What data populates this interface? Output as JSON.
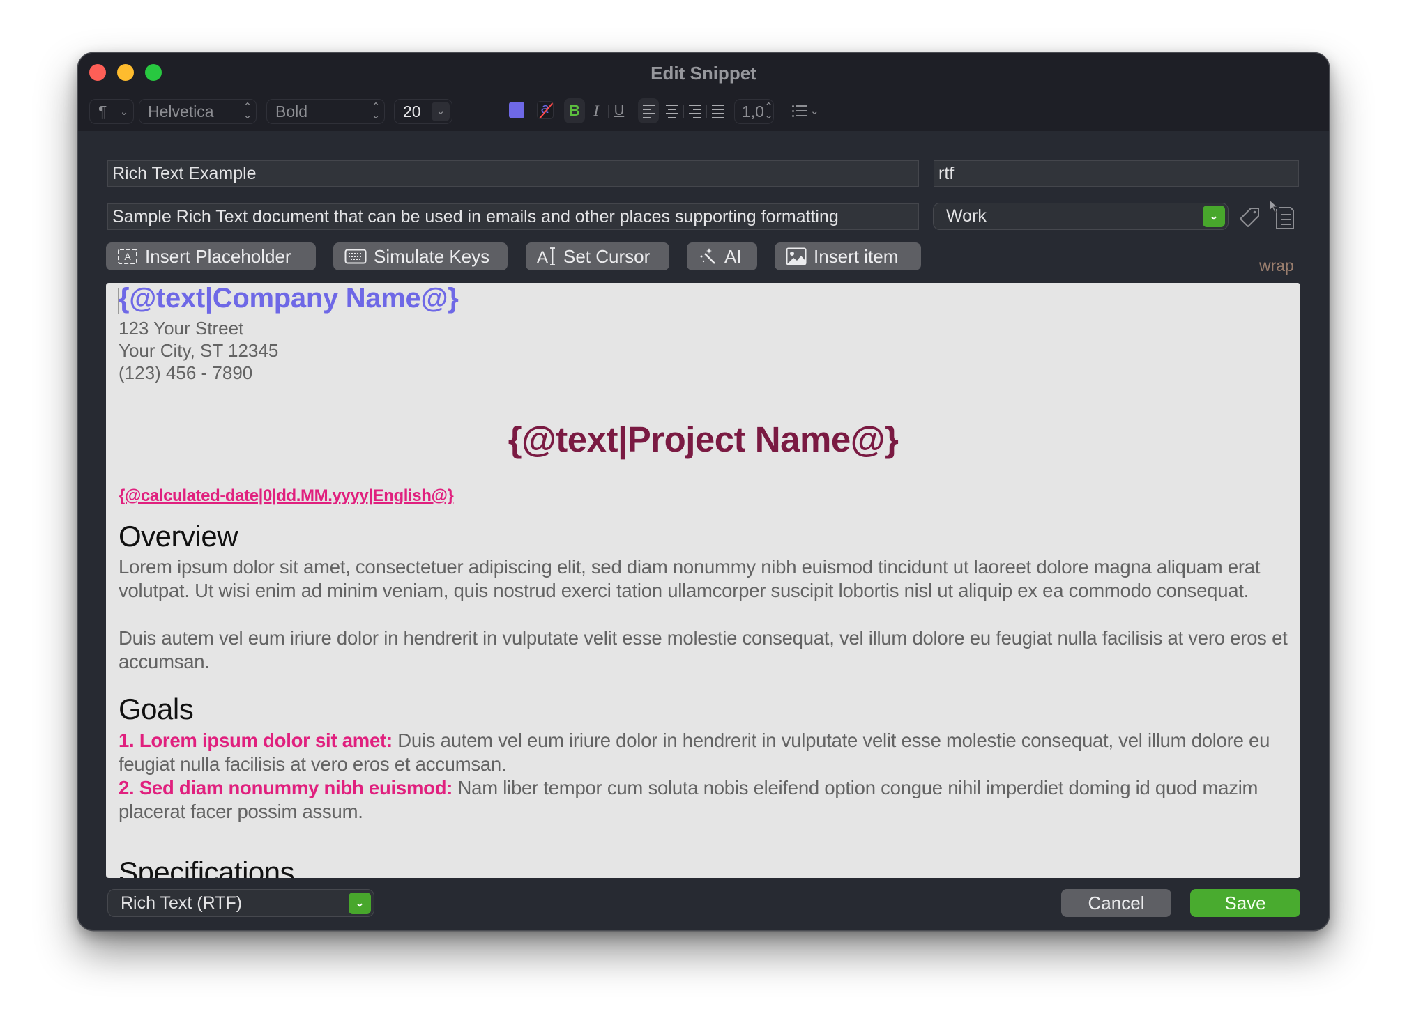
{
  "window": {
    "title": "Edit Snippet"
  },
  "toolbar": {
    "paragraph_glyph": "¶",
    "font_family": "Helvetica",
    "font_weight": "Bold",
    "font_size": "20",
    "text_color": "#6e68e6",
    "background_color_label": "a",
    "bold_label": "B",
    "italic_label": "I",
    "underline_label": "U",
    "line_spacing": "1,0",
    "chevron": "⌄",
    "updown": "⌃⌄"
  },
  "fields": {
    "title": "Rich Text Example",
    "abbreviation": "rtf",
    "description": "Sample Rich Text document that can be used in emails and other places supporting formatting",
    "folder": "Work"
  },
  "actions": {
    "insert_placeholder": "Insert Placeholder",
    "simulate_keys": "Simulate Keys",
    "set_cursor": "Set Cursor",
    "ai": "AI",
    "insert_item": "Insert item",
    "wrap": "wrap"
  },
  "editor": {
    "company_placeholder": "{@text|Company Name@}",
    "address_lines": [
      "123 Your Street",
      "Your City, ST 12345",
      "(123) 456 - 7890"
    ],
    "project_placeholder": "{@text|Project Name@}",
    "date_placeholder": "{@calculated-date|0|dd.MM.yyyy|English@}",
    "overview_heading": "Overview",
    "overview_p1": "Lorem ipsum dolor sit amet, consectetuer adipiscing elit, sed diam nonummy nibh euismod tincidunt ut laoreet dolore magna aliquam erat volutpat. Ut wisi enim ad minim veniam, quis nostrud exerci tation ullamcorper suscipit lobortis nisl ut aliquip ex ea commodo consequat.",
    "overview_p2": "Duis autem vel eum iriure dolor in hendrerit in vulputate velit esse molestie consequat, vel illum dolore eu feugiat nulla facilisis at vero eros et accumsan.",
    "goals_heading": "Goals",
    "goals": [
      {
        "key": "1. Lorem ipsum dolor sit amet:",
        "text": " Duis autem vel eum iriure dolor in hendrerit in vulputate velit esse molestie consequat, vel illum dolore eu feugiat nulla facilisis at vero eros et accumsan."
      },
      {
        "key": "2. Sed diam nonummy nibh euismod:",
        "text": " Nam liber tempor cum soluta nobis eleifend option congue nihil imperdiet doming id quod mazim placerat facer possim assum."
      }
    ],
    "specs_heading": "Specifications"
  },
  "footer": {
    "snippet_type": "Rich Text (RTF)",
    "cancel": "Cancel",
    "save": "Save"
  },
  "colors": {
    "accent_green": "#48a72c",
    "placeholder_purple": "#6e68e6",
    "project_maroon": "#7a1a42",
    "highlight_pink": "#e0207e"
  }
}
